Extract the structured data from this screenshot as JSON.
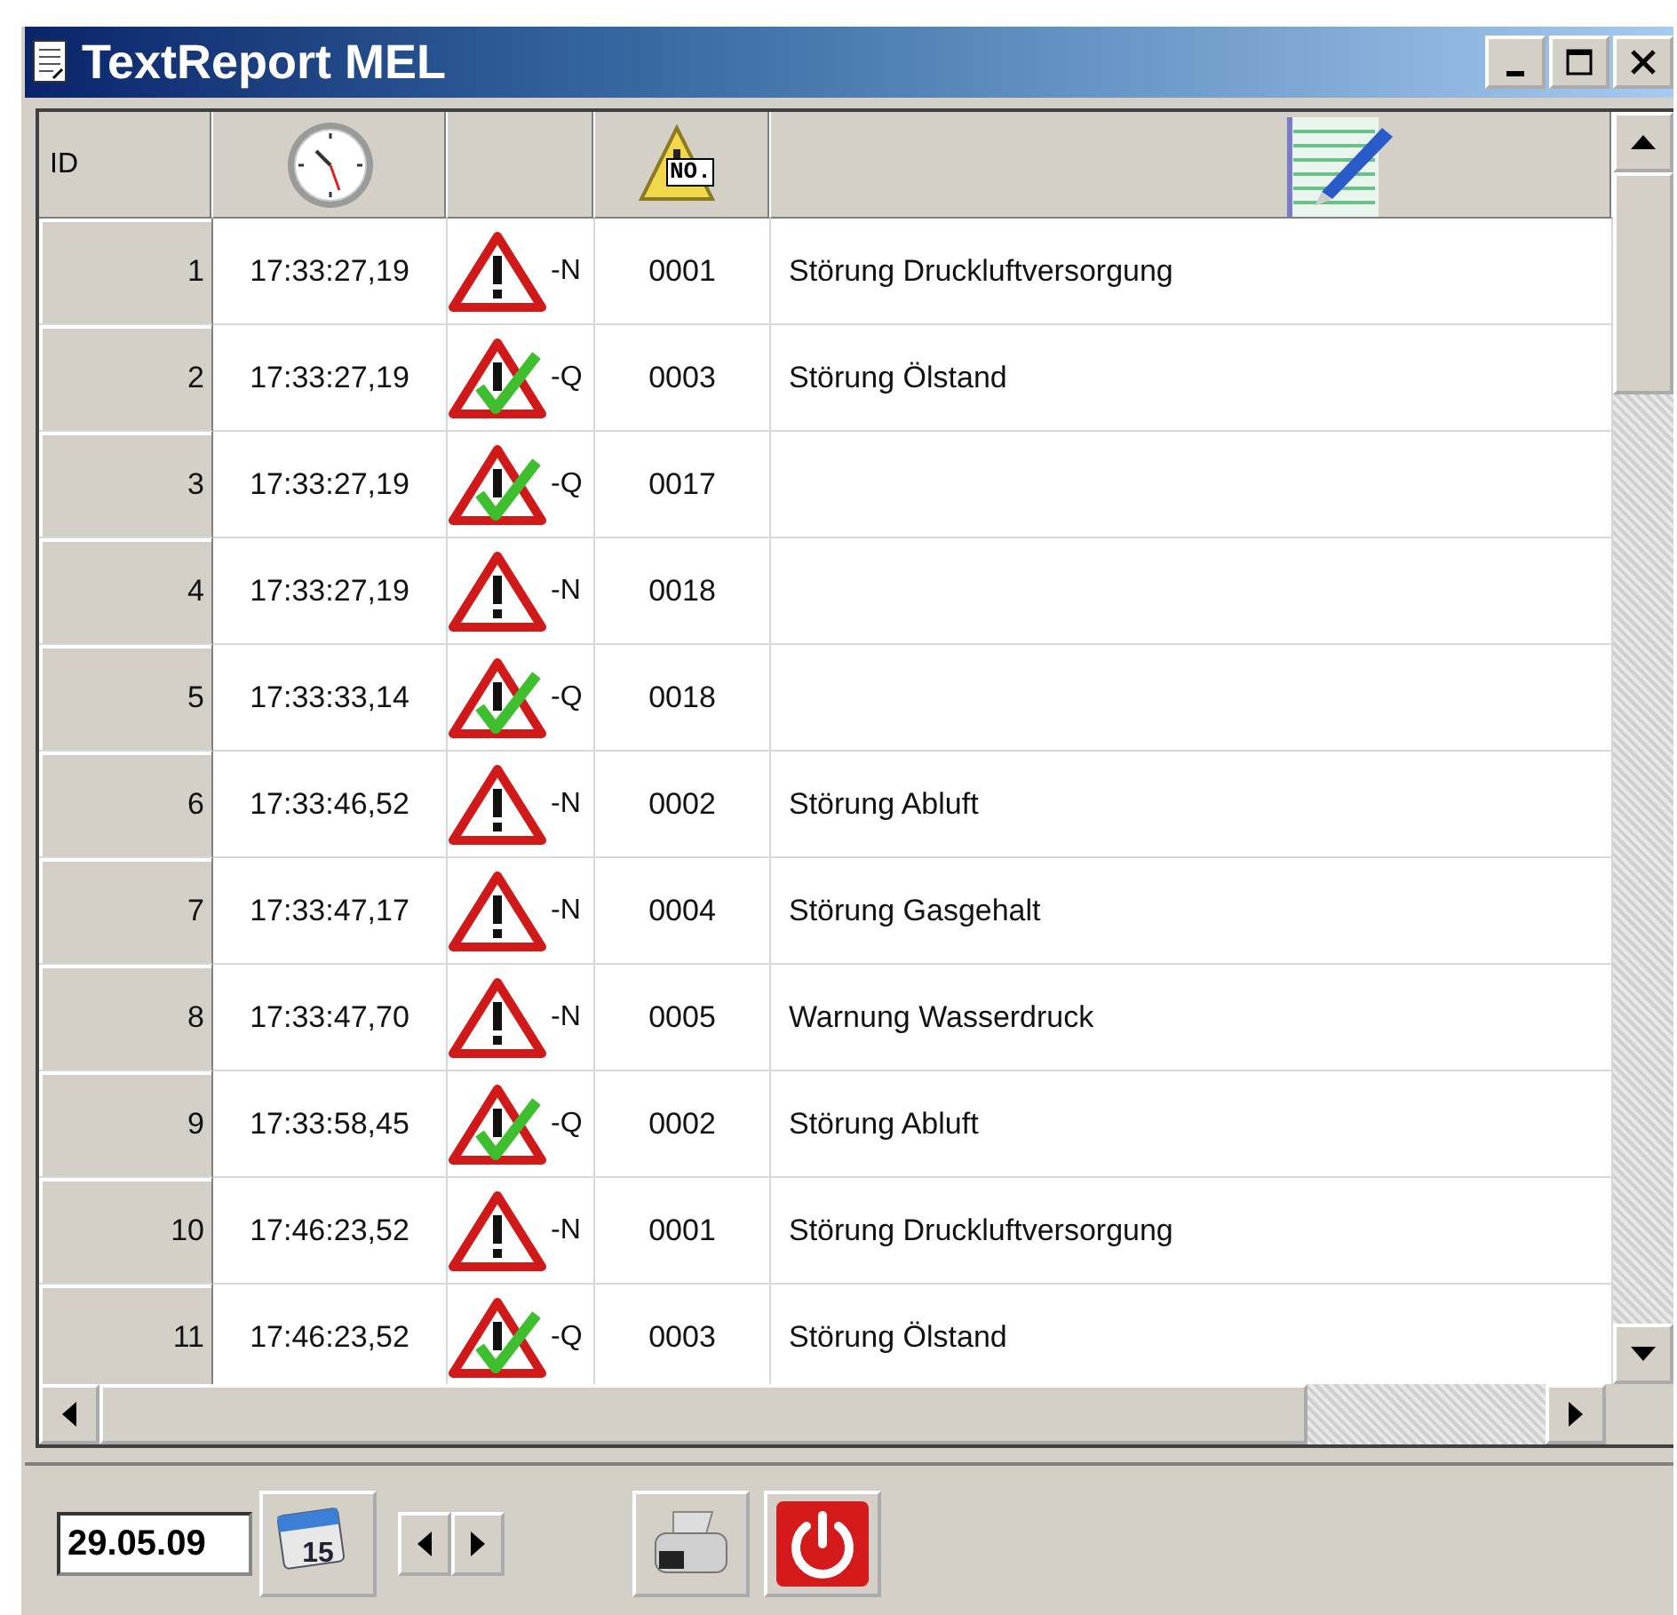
{
  "window": {
    "title": "TextReport MEL"
  },
  "table": {
    "columns": [
      {
        "label": "ID"
      }
    ],
    "header_badge": "NO.",
    "rows": [
      {
        "id": "1",
        "time": "17:33:27,19",
        "kind": "alarm",
        "suffix": "-N",
        "number": "0001",
        "text": "Störung Druckluftversorgung"
      },
      {
        "id": "2",
        "time": "17:33:27,19",
        "kind": "acknowledged",
        "suffix": "-Q",
        "number": "0003",
        "text": "Störung Ölstand"
      },
      {
        "id": "3",
        "time": "17:33:27,19",
        "kind": "acknowledged",
        "suffix": "-Q",
        "number": "0017",
        "text": ""
      },
      {
        "id": "4",
        "time": "17:33:27,19",
        "kind": "alarm",
        "suffix": "-N",
        "number": "0018",
        "text": ""
      },
      {
        "id": "5",
        "time": "17:33:33,14",
        "kind": "acknowledged",
        "suffix": "-Q",
        "number": "0018",
        "text": ""
      },
      {
        "id": "6",
        "time": "17:33:46,52",
        "kind": "alarm",
        "suffix": "-N",
        "number": "0002",
        "text": "Störung Abluft"
      },
      {
        "id": "7",
        "time": "17:33:47,17",
        "kind": "alarm",
        "suffix": "-N",
        "number": "0004",
        "text": "Störung Gasgehalt"
      },
      {
        "id": "8",
        "time": "17:33:47,70",
        "kind": "alarm",
        "suffix": "-N",
        "number": "0005",
        "text": "Warnung Wasserdruck"
      },
      {
        "id": "9",
        "time": "17:33:58,45",
        "kind": "acknowledged",
        "suffix": "-Q",
        "number": "0002",
        "text": "Störung Abluft"
      },
      {
        "id": "10",
        "time": "17:46:23,52",
        "kind": "alarm",
        "suffix": "-N",
        "number": "0001",
        "text": "Störung Druckluftversorgung"
      },
      {
        "id": "11",
        "time": "17:46:23,52",
        "kind": "acknowledged",
        "suffix": "-Q",
        "number": "0003",
        "text": "Störung Ölstand"
      }
    ]
  },
  "toolbar": {
    "date": "29.05.09",
    "calendar_day": "15"
  }
}
